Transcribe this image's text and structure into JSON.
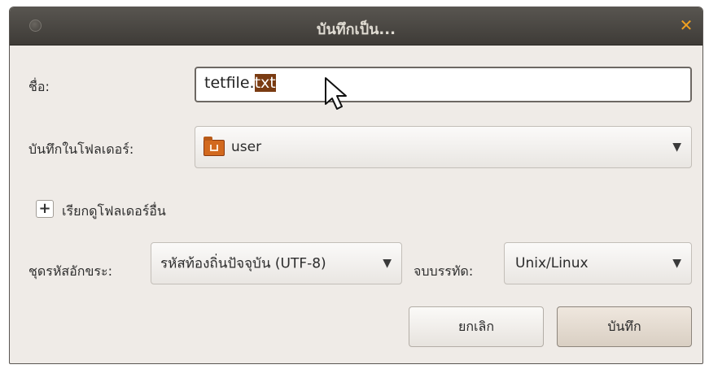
{
  "window": {
    "title": "บันทึกเป็น...",
    "close_glyph": "✕"
  },
  "name_field": {
    "label": "ชื่อ:",
    "value_base": "tetfile.",
    "value_selected": "txt"
  },
  "folder": {
    "label": "บันทึกในโฟลเดอร์:",
    "value": "user",
    "icon": "home-folder-icon"
  },
  "browse": {
    "label": "เรียกดูโฟลเดอร์อื่น",
    "expander_glyph": "+"
  },
  "encoding": {
    "label": "ชุดรหัสอักขระ:",
    "value": "รหัสท้องถิ่นปัจจุบัน (UTF-8)"
  },
  "line_ending": {
    "label": "จบบรรทัด:",
    "value": "Unix/Linux"
  },
  "buttons": {
    "cancel": "ยกเลิก",
    "save": "บันทึก"
  },
  "colors": {
    "selection": "#7a3b12",
    "titlebar": "#46433f",
    "accent_close": "#f0a020"
  }
}
